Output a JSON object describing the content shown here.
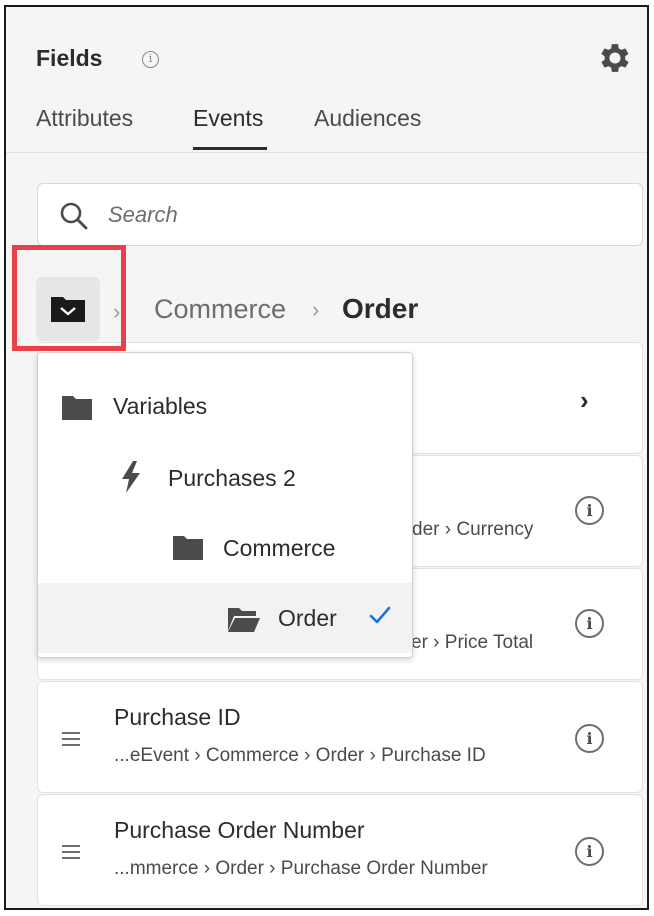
{
  "panel": {
    "title": "Fields",
    "title_info_glyph": "i",
    "settings_icon": "gear-icon"
  },
  "tabs": [
    {
      "label": "Attributes",
      "active": false
    },
    {
      "label": "Events",
      "active": true
    },
    {
      "label": "Audiences",
      "active": false
    }
  ],
  "search": {
    "placeholder": "Search",
    "value": ""
  },
  "breadcrumb": {
    "folder_icon": "folder-open-icon",
    "items": [
      "Commerce",
      "Order"
    ],
    "separator": "›"
  },
  "dropdown": {
    "items": [
      {
        "label": "Variables",
        "icon": "folder-icon",
        "selected": false
      },
      {
        "label": "Purchases 2",
        "icon": "lightning-icon",
        "selected": false
      },
      {
        "label": "Commerce",
        "icon": "folder-icon",
        "selected": false
      },
      {
        "label": "Order",
        "icon": "folder-open-icon",
        "selected": true
      }
    ]
  },
  "cards": [
    {
      "title": "",
      "path": "",
      "chevron": "›"
    },
    {
      "title": "",
      "path": "der › Currency",
      "info_glyph": "i"
    },
    {
      "title": "",
      "path": "er › Price Total",
      "info_glyph": "i"
    },
    {
      "title": "Purchase ID",
      "path": "...eEvent › Commerce › Order › Purchase ID",
      "info_glyph": "i"
    },
    {
      "title": "Purchase Order Number",
      "path": "...mmerce › Order › Purchase Order Number",
      "info_glyph": "i"
    }
  ],
  "colors": {
    "highlight": "#e8414b",
    "accent": "#1473e6",
    "text": "#2c2c2c"
  }
}
